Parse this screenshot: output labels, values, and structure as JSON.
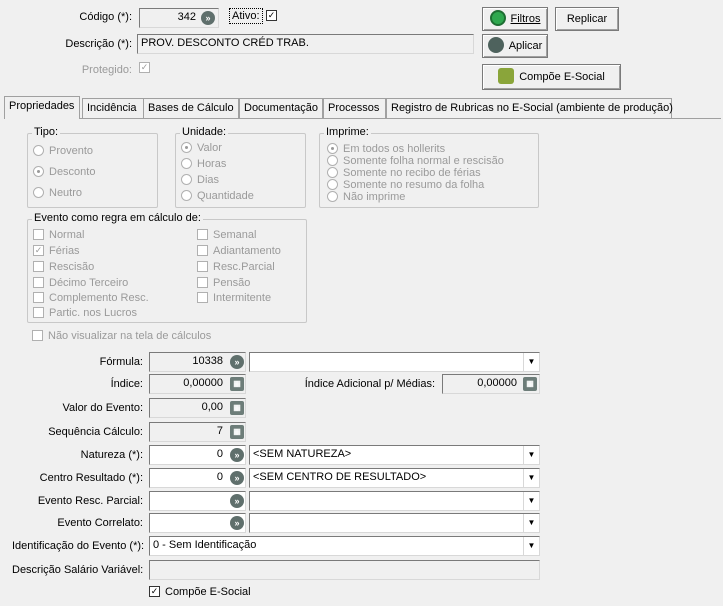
{
  "header": {
    "codigo_label": "Código (*):",
    "codigo_value": "342",
    "ativo_label": "Ativo:",
    "ativo_checked": "✓",
    "descricao_label": "Descrição (*):",
    "descricao_value": "PROV. DESCONTO CRÉD TRAB.",
    "protegido_label": "Protegido:",
    "protegido_checked": "✓"
  },
  "buttons": {
    "filtros": "Filtros",
    "replicar": "Replicar",
    "aplicar": "Aplicar",
    "compoe": "Compõe E-Social"
  },
  "tabs": [
    {
      "label": "Propriedades"
    },
    {
      "label": "Incidência"
    },
    {
      "label": "Bases de Cálculo"
    },
    {
      "label": "Documentação"
    },
    {
      "label": "Processos"
    },
    {
      "label": "Registro de Rubricas no E-Social (ambiente de produção)"
    }
  ],
  "tipo": {
    "title": "Tipo:",
    "options": [
      "Provento",
      "Desconto",
      "Neutro"
    ],
    "selected": "Desconto"
  },
  "unidade": {
    "title": "Unidade:",
    "options": [
      "Valor",
      "Horas",
      "Dias",
      "Quantidade"
    ],
    "selected": "Valor"
  },
  "imprime": {
    "title": "Imprime:",
    "options": [
      "Em todos os hollerits",
      "Somente folha normal e rescisão",
      "Somente no recibo de férias",
      "Somente no resumo da folha",
      "Não imprime"
    ],
    "selected": "Em todos os hollerits"
  },
  "evento": {
    "title": "Evento como regra em cálculo de:",
    "left": [
      "Normal",
      "Férias",
      "Rescisão",
      "Décimo Terceiro",
      "Complemento Resc.",
      "Partic. nos Lucros"
    ],
    "right": [
      "Semanal",
      "Adiantamento",
      "Resc.Parcial",
      "Pensão",
      "Intermitente"
    ],
    "checked": "✓"
  },
  "nao_visualizar": "Não visualizar na tela de cálculos",
  "form": {
    "formula_label": "Fórmula:",
    "formula_value": "10338",
    "indice_label": "Índice:",
    "indice_value": "0,00000",
    "indice_adic_label": "Índice Adicional p/ Médias:",
    "indice_adic_value": "0,00000",
    "valor_label": "Valor do Evento:",
    "valor_value": "0,00",
    "sequencia_label": "Sequência Cálculo:",
    "sequencia_value": "7",
    "natureza_label": "Natureza (*):",
    "natureza_value": "0",
    "natureza_combo": "<SEM NATUREZA>",
    "centro_label": "Centro Resultado (*):",
    "centro_value": "0",
    "centro_combo": "<SEM CENTRO DE RESULTADO>",
    "resc_label": "Evento Resc. Parcial:",
    "correlato_label": "Evento Correlato:",
    "ident_label": "Identificação do Evento (*):",
    "ident_combo": "0 - Sem Identificação",
    "salario_label": "Descrição Salário Variável:",
    "compoe_label": "Compõe E-Social",
    "compoe_checked": "✓"
  },
  "icons": {
    "go": "»",
    "calc": "▦",
    "arrow": "▼"
  }
}
